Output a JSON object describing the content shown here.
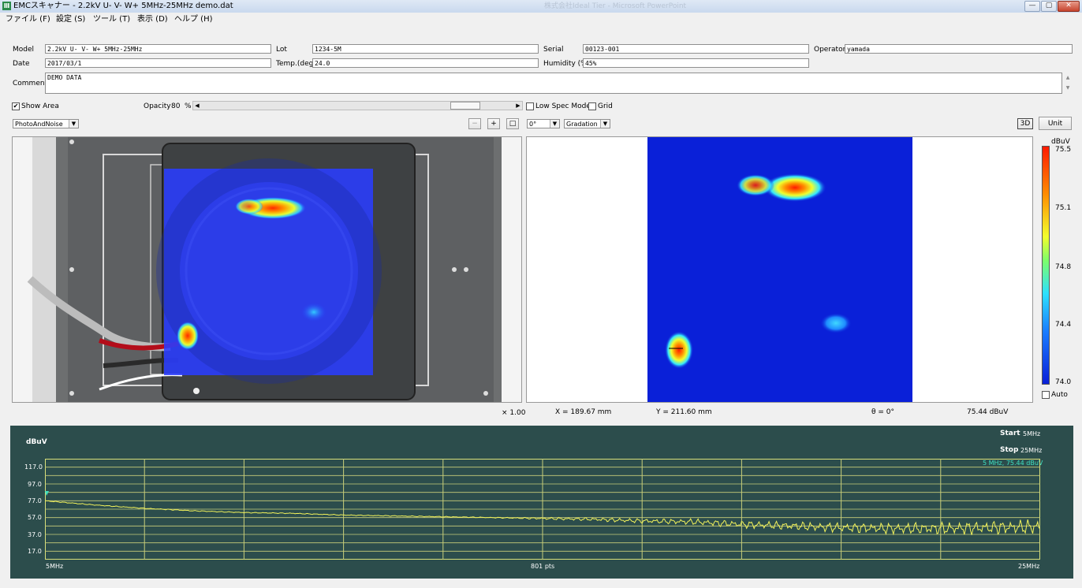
{
  "window": {
    "title": "EMCスキャナー - 2.2kV U- V- W+ 5MHz-25MHz demo.dat",
    "app_icon": "Ⅲ",
    "ghost_title": "株式会社Ideal Tier - Microsoft PowerPoint",
    "controls": [
      "—",
      "▢",
      "✕"
    ]
  },
  "menu": [
    "ファイル (F)",
    "設定 (S)",
    "ツール (T)",
    "表示 (D)",
    "ヘルプ (H)"
  ],
  "info": {
    "model_label": "Model",
    "model": "2.2kV U- V- W+ 5MHz-25MHz",
    "lot_label": "Lot",
    "lot": "1234-5M",
    "serial_label": "Serial",
    "serial": "00123-001",
    "operator_label": "Operator",
    "operator": "yamada",
    "date_label": "Date",
    "date": "2017/03/1",
    "temp_label": "Temp.(deg)",
    "temp": "24.0",
    "humidity_label": "Humidity (%)",
    "humidity": "45%",
    "comment_label": "Comment",
    "comment": "DEMO DATA"
  },
  "controls": {
    "show_area_label": "Show Area",
    "show_area_checked": true,
    "opacity_label": "Opacity",
    "opacity_value": "80",
    "opacity_unit": "%",
    "low_spec_label": "Low Spec Mode",
    "grid_label": "Grid",
    "view_mode": "PhotoAndNoise",
    "zoom_out": "−",
    "zoom_in": "+",
    "fit": "□",
    "rotation": "0°",
    "color_mode": "Gradation",
    "btn_3d": "3D",
    "btn_unit": "Unit"
  },
  "photo": {
    "scale_label": "× 1.00"
  },
  "colorbar": {
    "unit": "dBuV",
    "max": "75.5",
    "ticks": [
      "75.1",
      "74.8",
      "74.4"
    ],
    "min": "74.0",
    "auto_label": "Auto"
  },
  "readout": {
    "x": "X = 189.67 mm",
    "y": "Y = 211.60 mm",
    "theta": "θ = 0°",
    "value": "75.44 dBuV"
  },
  "spectrum": {
    "ylabel": "dBuV",
    "start_label": "Start",
    "start_value": "5MHz",
    "stop_label": "Stop",
    "stop_value": "25MHz",
    "marker": "5 MHz, 75.44 dBuV",
    "x_left": "5MHz",
    "x_mid": "801 pts",
    "x_right": "25MHz",
    "yticks": [
      "117.0",
      "97.0",
      "77.0",
      "57.0",
      "37.0",
      "17.0"
    ]
  },
  "chart_data": {
    "type": "line",
    "xlabel": "",
    "ylabel": "dBuV",
    "xlim": [
      5,
      25
    ],
    "ylim": [
      7,
      127
    ],
    "grid": true,
    "x": [
      5,
      6,
      7,
      8,
      9,
      10,
      11,
      12,
      13,
      14,
      15,
      16,
      17,
      18,
      19,
      20,
      21,
      22,
      23,
      24,
      25
    ],
    "y": [
      77,
      72,
      68,
      65,
      63,
      62,
      60,
      59,
      58,
      57,
      56,
      55,
      53,
      52,
      49,
      47,
      45,
      44,
      44,
      45,
      46
    ]
  }
}
